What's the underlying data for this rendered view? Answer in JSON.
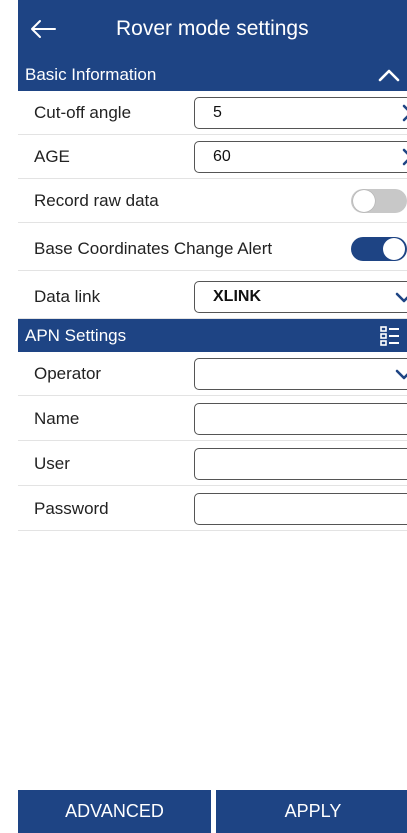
{
  "header": {
    "title": "Rover mode settings",
    "back_icon": "arrow-left-icon"
  },
  "basic": {
    "title": "Basic Information",
    "cutoff": {
      "label": "Cut-off angle",
      "value": "5"
    },
    "age": {
      "label": "AGE",
      "value": "60"
    },
    "record_raw": {
      "label": "Record raw data",
      "on": false
    },
    "base_alert": {
      "label": "Base Coordinates Change Alert",
      "on": true
    },
    "data_link": {
      "label": "Data link",
      "value": "XLINK"
    }
  },
  "apn": {
    "title": "APN Settings",
    "operator": {
      "label": "Operator",
      "value": ""
    },
    "name": {
      "label": "Name",
      "value": ""
    },
    "user": {
      "label": "User",
      "value": ""
    },
    "password": {
      "label": "Password",
      "value": ""
    }
  },
  "buttons": {
    "advanced": "ADVANCED",
    "apply": "APPLY"
  },
  "colors": {
    "primary": "#1e4484",
    "toggle_off": "#c8c8c8"
  }
}
